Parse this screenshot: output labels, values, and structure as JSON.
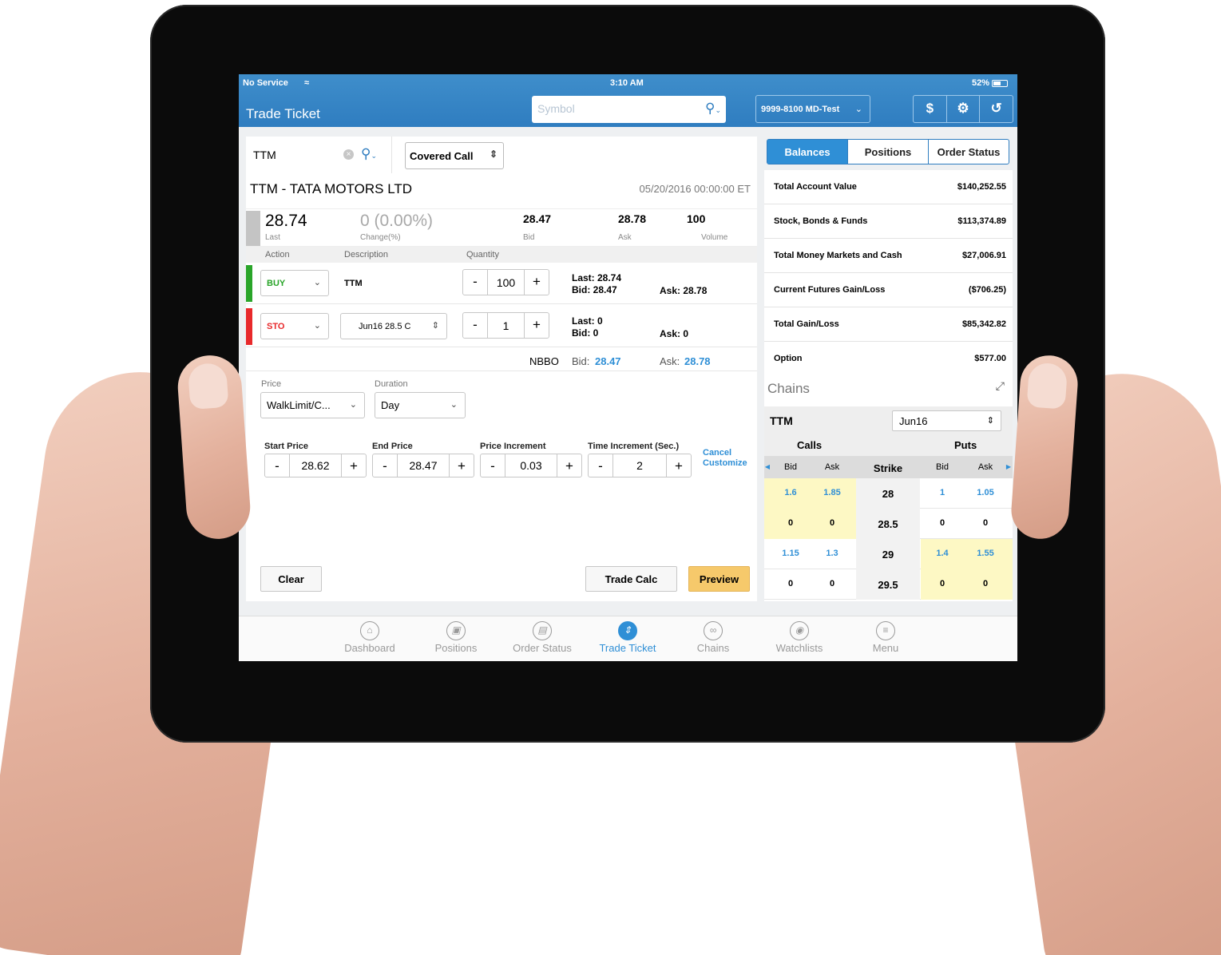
{
  "status_bar": {
    "carrier": "No Service",
    "time": "3:10 AM",
    "battery": "52%"
  },
  "header": {
    "title": "Trade Ticket",
    "symbol_placeholder": "Symbol",
    "account": "9999-8100 MD-Test",
    "buttons": [
      "$",
      "⚙",
      "↺"
    ]
  },
  "ticket": {
    "symbol": "TTM",
    "strategy": "Covered Call",
    "company": "TTM -  TATA MOTORS LTD",
    "datetime": "05/20/2016 00:00:00 ET",
    "quote": {
      "last": "28.74",
      "last_label": "Last",
      "change": "0 (0.00%)",
      "change_label": "Change(%)",
      "bid": "28.47",
      "bid_label": "Bid",
      "ask": "28.78",
      "ask_label": "Ask",
      "volume": "100",
      "volume_label": "Volume"
    },
    "columns": [
      "Action",
      "Description",
      "Quantity"
    ],
    "legs": [
      {
        "action": "BUY",
        "description": "TTM",
        "quantity": "100",
        "last": "Last: 28.74",
        "bid": "Bid: 28.47",
        "ask": "Ask: 28.78",
        "color": "#2aa52a"
      },
      {
        "action": "STO",
        "description": "Jun16 28.5 C",
        "quantity": "1",
        "last": "Last: 0",
        "bid": "Bid: 0",
        "ask": "Ask: 0",
        "color": "#e8292b"
      }
    ],
    "nbbo": {
      "label": "NBBO",
      "bid_label": "Bid:",
      "bid": "28.47",
      "ask_label": "Ask:",
      "ask": "28.78"
    },
    "price_label": "Price",
    "price_value": "WalkLimit/C...",
    "duration_label": "Duration",
    "duration_value": "Day",
    "walk": [
      {
        "label": "Start Price",
        "value": "28.62"
      },
      {
        "label": "End Price",
        "value": "28.47"
      },
      {
        "label": "Price Increment",
        "value": "0.03"
      },
      {
        "label": "Time Increment (Sec.)",
        "value": "2"
      }
    ],
    "minus": "-",
    "plus": "+",
    "cancel_link": "Cancel",
    "customize_link": "Customize",
    "clear_btn": "Clear",
    "tradecalc_btn": "Trade Calc",
    "preview_btn": "Preview"
  },
  "account_panel": {
    "tabs": [
      "Balances",
      "Positions",
      "Order Status"
    ],
    "balances": [
      {
        "label": "Total Account Value",
        "value": "$140,252.55"
      },
      {
        "label": "Stock, Bonds & Funds",
        "value": "$113,374.89"
      },
      {
        "label": "Total Money Markets and Cash",
        "value": "$27,006.91"
      },
      {
        "label": "Current Futures Gain/Loss",
        "value": "($706.25)"
      },
      {
        "label": "Total Gain/Loss",
        "value": "$85,342.82"
      },
      {
        "label": "Option",
        "value": "$577.00"
      }
    ]
  },
  "chains": {
    "title": "Chains",
    "symbol": "TTM",
    "expiry": "Jun16",
    "calls_label": "Calls",
    "puts_label": "Puts",
    "headers": {
      "bid": "Bid",
      "ask": "Ask",
      "strike": "Strike",
      "bid2": "Bid",
      "ask2": "Ask"
    },
    "rows": [
      {
        "cbid": "1.6",
        "cask": "1.85",
        "strike": "28",
        "pbid": "1",
        "pask": "1.05"
      },
      {
        "cbid": "0",
        "cask": "0",
        "strike": "28.5",
        "pbid": "0",
        "pask": "0"
      },
      {
        "cbid": "1.15",
        "cask": "1.3",
        "strike": "29",
        "pbid": "1.4",
        "pask": "1.55"
      },
      {
        "cbid": "0",
        "cask": "0",
        "strike": "29.5",
        "pbid": "0",
        "pask": "0"
      }
    ]
  },
  "tabbar": [
    {
      "label": "Dashboard",
      "icon": "home-icon"
    },
    {
      "label": "Positions",
      "icon": "briefcase-icon"
    },
    {
      "label": "Order Status",
      "icon": "document-icon"
    },
    {
      "label": "Trade Ticket",
      "icon": "trade-ticket-icon",
      "active": true
    },
    {
      "label": "Chains",
      "icon": "chain-icon"
    },
    {
      "label": "Watchlists",
      "icon": "eye-icon"
    },
    {
      "label": "Menu",
      "icon": "menu-icon"
    }
  ]
}
